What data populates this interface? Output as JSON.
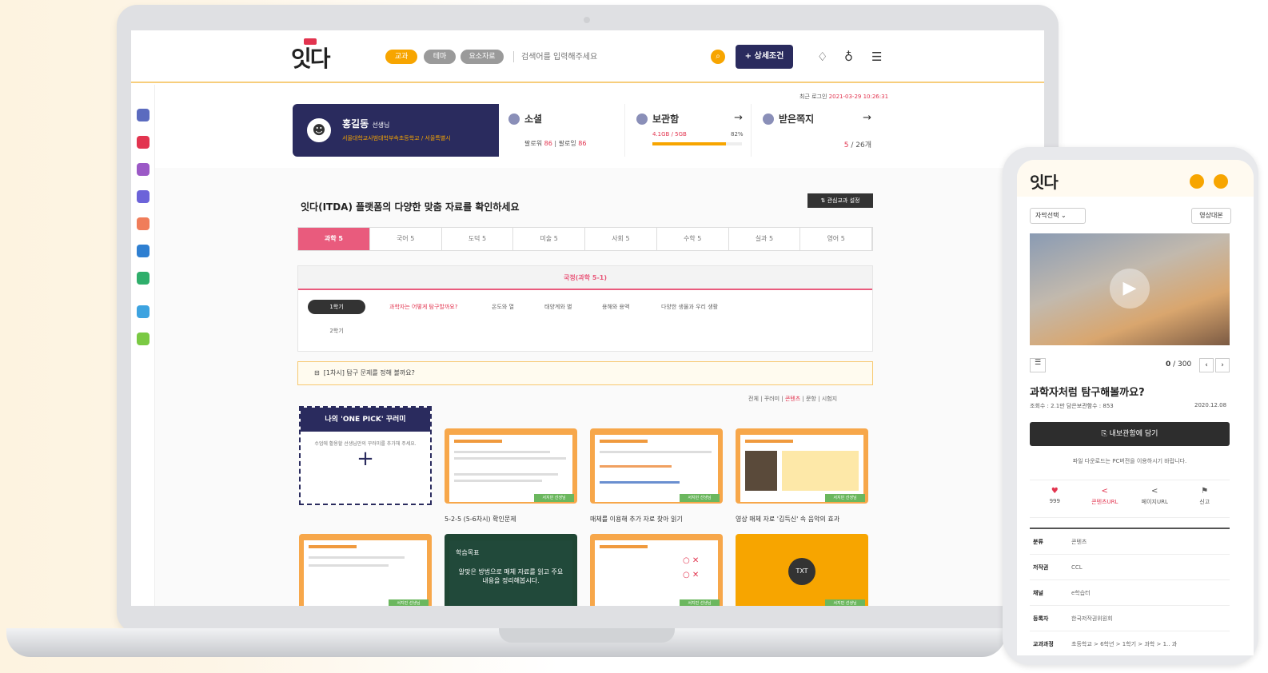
{
  "header": {
    "pills": [
      "교과",
      "테마",
      "요소자료"
    ],
    "search_placeholder": "검색어를 입력해주세요",
    "detail_button": "+ 상세조건"
  },
  "profile": {
    "last_login_label": "최근 로그인",
    "last_login_time": "2021-03-29 10:26:31",
    "name": "홍길동",
    "role": "선생님",
    "school": "서울대학교사범대학부속초등학교 / 서울특별시"
  },
  "cards": {
    "social": {
      "title": "소셜",
      "follower_label": "팔로워",
      "follower": "86",
      "following_label": "팔로잉",
      "following": "86"
    },
    "storage": {
      "title": "보관함",
      "used": "4.1GB / 5GB",
      "percent_text": "82%",
      "percent": 82
    },
    "messages": {
      "title": "받은쪽지",
      "count": "5",
      "total": "26개"
    }
  },
  "main": {
    "title": "잇다(ITDA) 플랫폼의 다양한 맞춤 자료를 확인하세요",
    "setting_button": "관심교과 설정",
    "subject_tabs": [
      "과학 5",
      "국어 5",
      "도덕 5",
      "미술 5",
      "사회 5",
      "수학 5",
      "실과 5",
      "영어 5"
    ],
    "textbook": "국정(과학 5-1)",
    "semester1": "1학기",
    "semester2": "2학기",
    "units": [
      "과학자는 어떻게 탐구할까요?",
      "온도와 열",
      "태양계와 별",
      "용해와 용액",
      "다양한 생물과 우리 생활"
    ],
    "notice": "[1차시] 탐구 문제를 정해 볼까요?",
    "filters": [
      "전체",
      "꾸러미",
      "콘텐츠",
      "문항",
      "시험지"
    ],
    "onepick_title": "나의 'ONE PICK' 꾸러미",
    "onepick_desc": "수업에 활용할 선생님만의 꾸러미를 추가해 주세요.",
    "onepick_plus": "+",
    "thumbs": [
      {
        "caption": "5-2-5 (5-6차시) 확인문제",
        "tag": "서지민 선생님"
      },
      {
        "caption": "매체를 이용해 추가 자료 찾아 읽기",
        "tag": "서지민 선생님"
      },
      {
        "caption": "영상 매체 자료 '김득신' 속 음악의 효과",
        "tag": "서지민 선생님"
      }
    ],
    "thumb_row2": [
      {
        "tag": "서지민 선생님"
      },
      {
        "title": "학습목표",
        "text": "알맞은 방법으로 매체 자료를 읽고 주요 내용을 정리해봅시다.",
        "tag": ""
      },
      {
        "tag": "서지민 선생님"
      },
      {
        "badge": "TXT",
        "tag": "서지민 선생님"
      }
    ]
  },
  "mobile": {
    "caption_select": "자막선택",
    "script_button": "영상대본",
    "count_current": "0",
    "count_total": "/ 300",
    "title": "과학자처럼 탐구해볼까요?",
    "meta": "조회수 : 2.1만    담은보관함수 : 853",
    "date": "2020.12.08",
    "save_button": "내보관함에 담기",
    "note": "파일 다운로드는 PC버전을 이용하시기 바랍니다.",
    "actions": [
      {
        "icon": "♥",
        "label": "999"
      },
      {
        "icon": "<",
        "label": "콘텐츠URL"
      },
      {
        "icon": "<",
        "label": "페이지URL"
      },
      {
        "icon": "⚑",
        "label": "신고"
      }
    ],
    "rows": [
      {
        "k": "분류",
        "v": "콘텐츠"
      },
      {
        "k": "저작권",
        "v": "CCL"
      },
      {
        "k": "채널",
        "v": "e학습터"
      },
      {
        "k": "등록자",
        "v": "한국저작권위원회"
      },
      {
        "k": "교과과정",
        "v": "초등학교 > 6학년 > 1학기 > 과학 > 1.. 과"
      }
    ]
  },
  "colors": {
    "accent": "#f7a500",
    "navy": "#2a2b5e",
    "pink": "#e95b7d",
    "red": "#e2344f"
  }
}
